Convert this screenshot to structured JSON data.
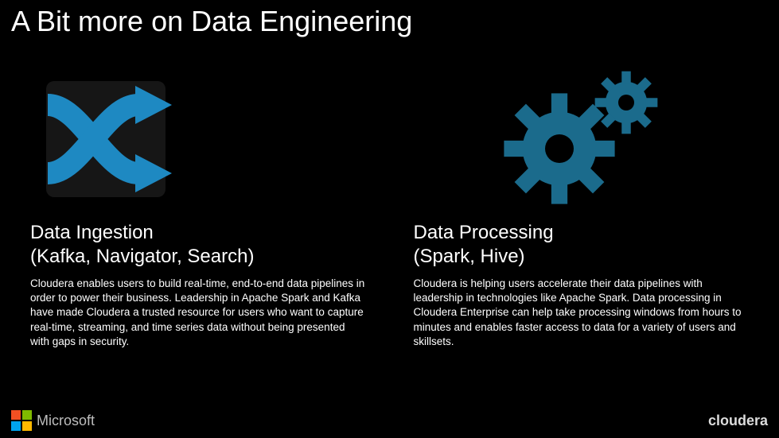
{
  "title": "A Bit more on Data Engineering",
  "columns": {
    "left": {
      "heading_line1": "Data Ingestion",
      "heading_line2": "(Kafka, Navigator, Search)",
      "body": "Cloudera enables users to build real-time, end-to-end data pipelines in order to power their business.  Leadership in Apache Spark and Kafka have made Cloudera a trusted resource for users who want to capture real-time, streaming, and time series data without being presented with gaps in security."
    },
    "right": {
      "heading_line1": "Data Processing",
      "heading_line2": "(Spark, Hive)",
      "body": "Cloudera is helping users accelerate their data pipelines with leadership in technologies like Apache Spark.  Data processing in Cloudera Enterprise can help take processing windows from hours to minutes and enables faster access to data for a variety of users and skillsets."
    }
  },
  "icons": {
    "ingestion_color": "#1e89c2",
    "processing_color": "#1b6b8c"
  },
  "footer": {
    "microsoft": "Microsoft",
    "cloudera": "cloudera"
  }
}
